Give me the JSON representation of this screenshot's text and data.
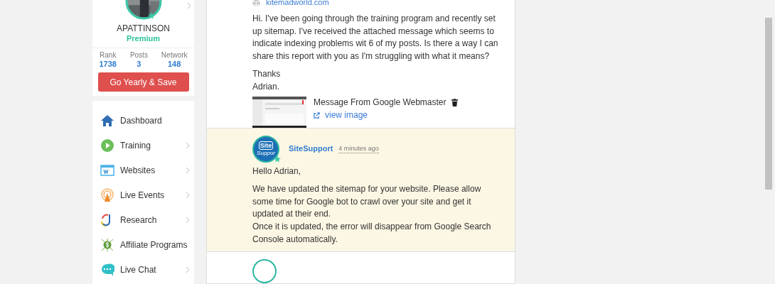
{
  "profile": {
    "username": "APATTINSON",
    "membership": "Premium",
    "stats": [
      {
        "label": "Rank",
        "value": "1738"
      },
      {
        "label": "Posts",
        "value": "3"
      },
      {
        "label": "Network",
        "value": "148"
      }
    ],
    "upgrade_button": "Go Yearly & Save"
  },
  "nav": [
    {
      "label": "Dashboard",
      "kind": "home",
      "has_submenu": false
    },
    {
      "label": "Training",
      "kind": "play",
      "has_submenu": true
    },
    {
      "label": "Websites",
      "kind": "web",
      "has_submenu": true
    },
    {
      "label": "Live Events",
      "kind": "broadcast",
      "has_submenu": true
    },
    {
      "label": "Research",
      "kind": "research",
      "has_submenu": true
    },
    {
      "label": "Affiliate Programs",
      "kind": "affiliate",
      "has_submenu": false
    },
    {
      "label": "Live Chat",
      "kind": "chat",
      "has_submenu": true
    }
  ],
  "question": {
    "website": "kitemadworld.com",
    "paragraphs": [
      "Hi. I've been going through the training program and recently set up sitemap. I've received the attached message which seems to indicate indexing problems wit 6 of my posts. Is there a way I can share this report with you as I'm struggling with what it means?",
      "Thanks\nAdrian."
    ],
    "attachment": {
      "title": "Message From Google Webmaster",
      "link": "view image"
    }
  },
  "reply": {
    "author": "SiteSupport",
    "avatar_text": "Site",
    "avatar_subtext": "Suppor",
    "time": "4 minutes ago",
    "paragraphs": [
      "Hello Adrian,",
      "We have updated the sitemap for your website. Please allow some time for Google bot to crawl over your site and get it updated at their end.\nOnce it is updated, the error will disappear from Google Search Console automatically."
    ]
  }
}
